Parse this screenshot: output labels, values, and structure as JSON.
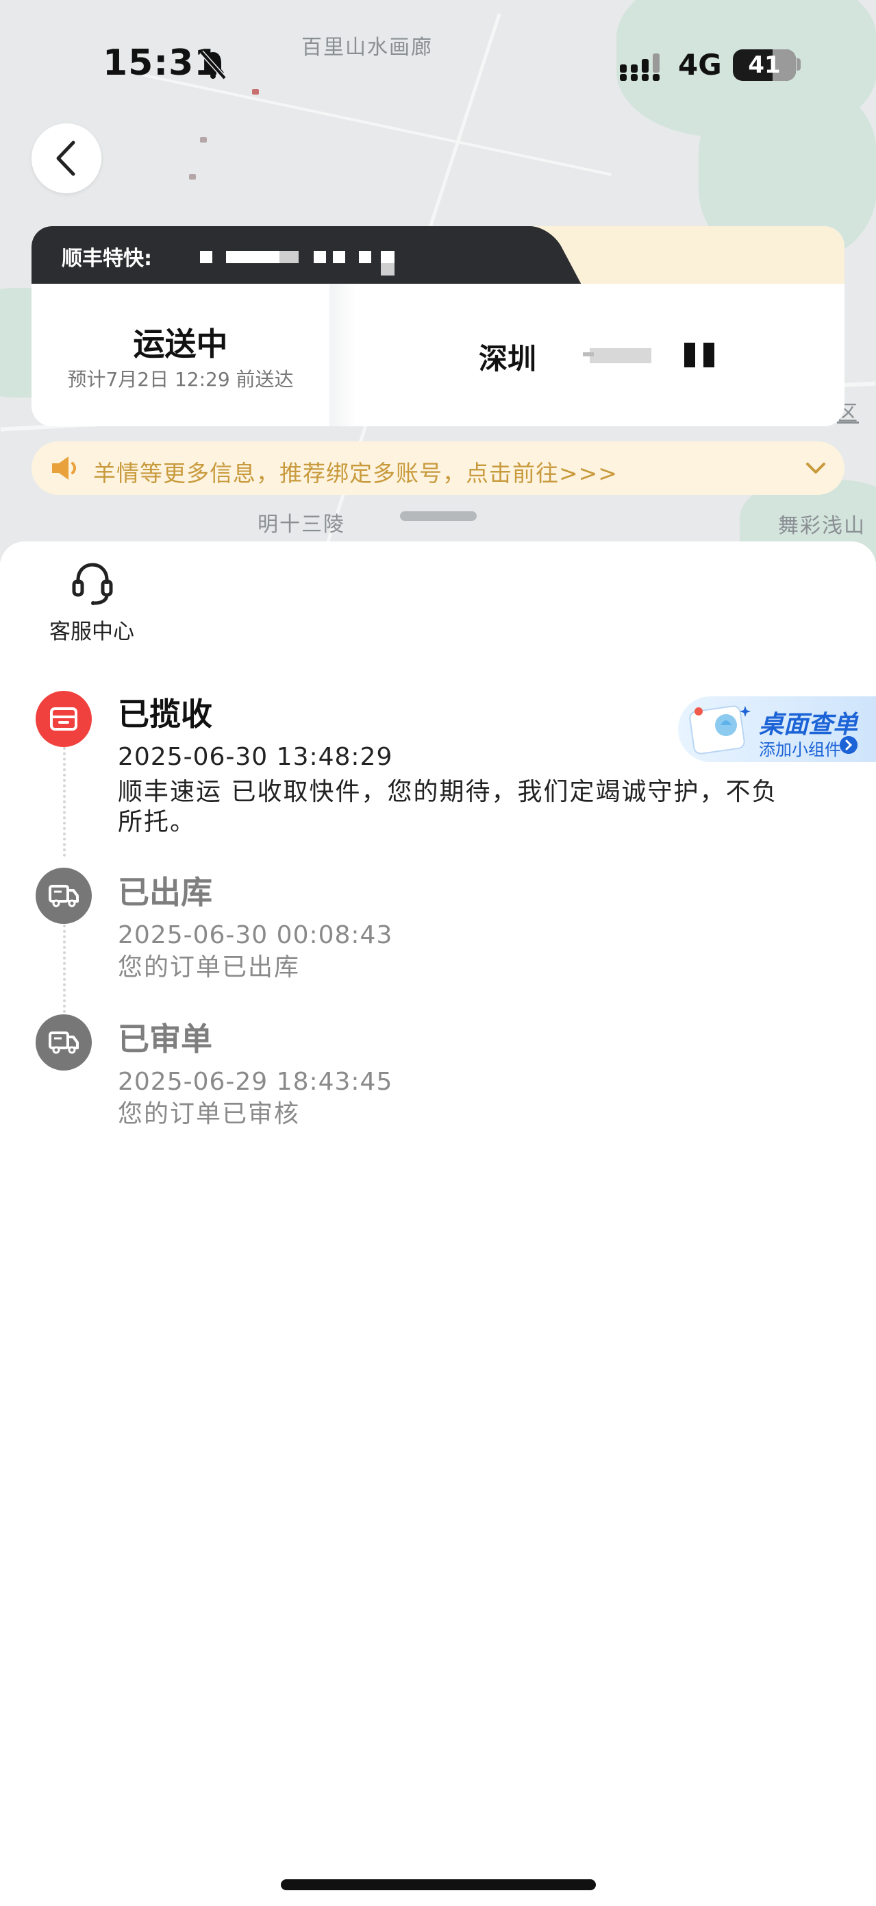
{
  "status_bar": {
    "time": "15:31",
    "network": "4G",
    "battery": "41"
  },
  "map": {
    "labels": [
      "百里山水画廊",
      "明十三陵",
      "舞彩浅山",
      "区"
    ]
  },
  "shipment": {
    "company": "顺丰特快:",
    "status": "运送中",
    "eta": "预计7月2日 12:29 前送达",
    "destination_city": "深圳"
  },
  "banner": {
    "text": "羊情等更多信息，推荐绑定多账号，点击前往>>>"
  },
  "customer_service": {
    "label": "客服中心"
  },
  "widget_promo": {
    "title": "桌面查单",
    "subtitle": "添加小组件"
  },
  "timeline": [
    {
      "title": "已揽收",
      "time": "2025-06-30 13:48:29",
      "description": "顺丰速运 已收取快件，您的期待，我们定竭诚守护，不负所托。",
      "icon": "pickup-box-icon"
    },
    {
      "title": "已出库",
      "time": "2025-06-30 00:08:43",
      "description": "您的订单已出库",
      "icon": "truck-icon"
    },
    {
      "title": "已审单",
      "time": "2025-06-29 18:43:45",
      "description": "您的订单已审核",
      "icon": "truck-icon"
    }
  ],
  "colors": {
    "accent_red": "#f0413e",
    "banner_text": "#c89a3c",
    "banner_bg": "#fdf3df",
    "widget_blue": "#1b63d6"
  }
}
